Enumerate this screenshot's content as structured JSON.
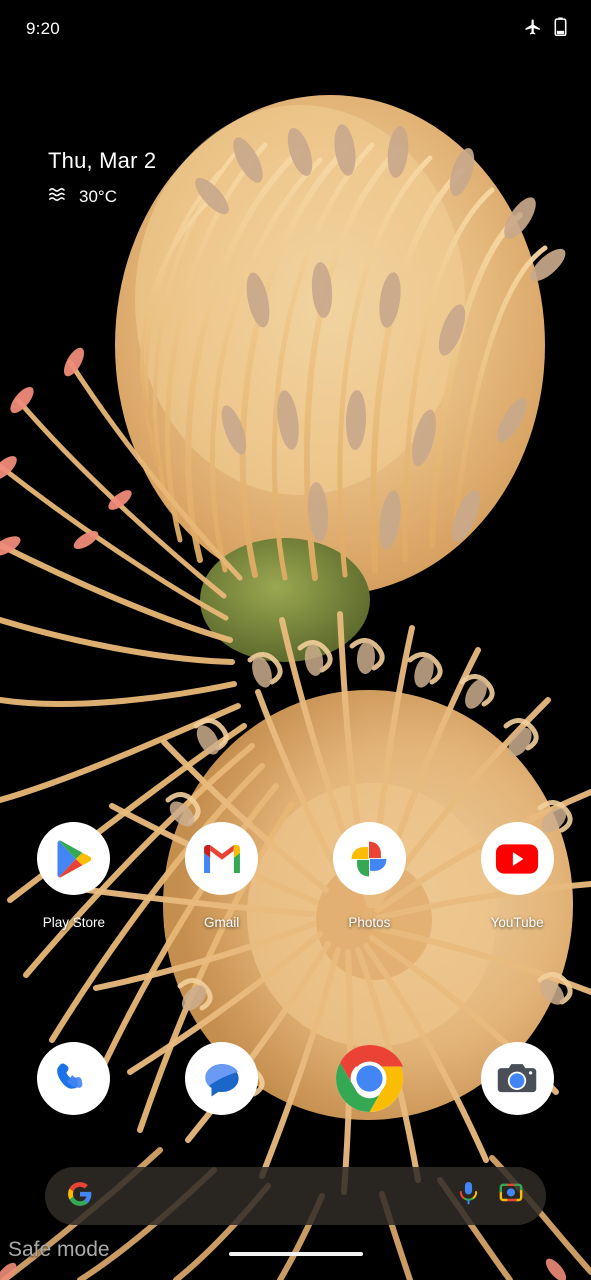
{
  "status_bar": {
    "time": "9:20",
    "icons": [
      {
        "name": "airplane-mode-icon",
        "label": "Airplane mode"
      },
      {
        "name": "battery-icon",
        "label": "Battery"
      }
    ]
  },
  "smartspace": {
    "date": "Thu, Mar 2",
    "weather_icon": "haze-icon",
    "temperature": "30°C"
  },
  "home_screen": {
    "apps": [
      {
        "label": "Play Store",
        "icon": "play-store-icon"
      },
      {
        "label": "Gmail",
        "icon": "gmail-icon"
      },
      {
        "label": "Photos",
        "icon": "google-photos-icon"
      },
      {
        "label": "YouTube",
        "icon": "youtube-icon"
      }
    ]
  },
  "dock": {
    "apps": [
      {
        "label": "Phone",
        "icon": "phone-icon"
      },
      {
        "label": "Messages",
        "icon": "messages-icon"
      },
      {
        "label": "Chrome",
        "icon": "chrome-icon"
      },
      {
        "label": "Camera",
        "icon": "camera-icon"
      }
    ]
  },
  "search": {
    "value": "",
    "placeholder": "",
    "logo_icon": "google-g-icon",
    "mic_icon": "microphone-icon",
    "lens_icon": "google-lens-icon"
  },
  "system": {
    "safe_mode_label": "Safe mode",
    "nav_pill": "home-gesture-pill"
  },
  "colors": {
    "background": "#000000",
    "wallpaper_petal": "#f0c07a",
    "wallpaper_petal_light": "#f6d9a8",
    "wallpaper_center": "#7f8a3c",
    "search_bar": "#302c28",
    "safe_mode_text": "#a9a9a9",
    "google_blue": "#4285f4",
    "google_red": "#ea4335",
    "google_yellow": "#fbbc04",
    "google_green": "#34a853",
    "youtube_red": "#ff0000"
  }
}
